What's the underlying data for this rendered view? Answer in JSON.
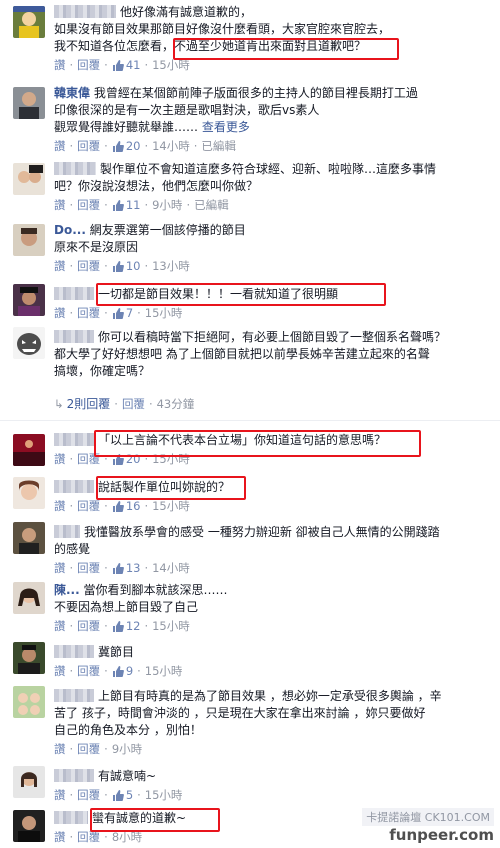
{
  "ui": {
    "like_label": "讚",
    "reply_label": "回覆",
    "like_icon": "thumbs-up-icon",
    "accent_color": "#3b5998",
    "highlight_color": "#e8141c"
  },
  "comments": [
    {
      "name": "Yoshi Yu Ting",
      "lines": [
        "他好像滿有誠意道歉的，",
        "如果沒有節目效果那節目好像沒什麼看頭，大家官腔來官腔去，",
        "我不知道各位怎麼看，不過至少她道肯出來面對且道歉吧？"
      ],
      "likes": "41",
      "time": "15小時"
    },
    {
      "name": "韓東偉",
      "lines": [
        "我曾經在某個節前陣子版面很多的主持人的節目裡長期打工過",
        "印像很深的是有一次主題是歌唱對決，歌后vs素人",
        "觀眾覺得誰好聽就舉誰……"
      ],
      "see_more": "查看更多",
      "likes": "20",
      "time": "14小時",
      "edited": "已編輯"
    },
    {
      "name": "",
      "lines": [
        "製作單位不會知道這麼多符合球經、迎新、啦啦隊…這麼多事情",
        "吧？你沒說沒想法，他們怎麼叫你做？"
      ],
      "likes": "11",
      "time": "9小時",
      "edited": "已編輯"
    },
    {
      "name": "Do...",
      "lines": [
        "網友票選第一個該停播的節目",
        "原來不是沒原因"
      ],
      "likes": "10",
      "time": "13小時"
    },
    {
      "name": "",
      "lines": [
        "一切都是節目效果！！！一看就知道了很明顯"
      ],
      "likes": "7",
      "time": "15小時"
    },
    {
      "name": "",
      "lines": [
        "你可以看稿時當下拒絕阿，有必要上個節目毀了一整個系名聲嗎？",
        "都大學了好好想想吧 為了上個節目就把以前學長姊辛苦建立起來的名聲",
        "搞壞，你確定嗎？"
      ],
      "likes": "",
      "time": "",
      "replies": "2則回覆",
      "reply_time": "43分鐘"
    },
    {
      "name": "",
      "lines": [
        "「以上言論不代表本台立場」你知道這句話的意思嗎？"
      ],
      "likes": "20",
      "time": "15小時"
    },
    {
      "name": "",
      "lines": [
        "說話製作單位叫妳說的？"
      ],
      "likes": "16",
      "time": "15小時"
    },
    {
      "name": "",
      "lines": [
        "我懂醫放系學會的感受 一種努力辦迎新 卻被自己人無情的公開踐踏",
        "的感覺"
      ],
      "likes": "13",
      "time": "14小時"
    },
    {
      "name": "陳...",
      "lines": [
        "當你看到腳本就該深思……",
        "不要因為想上節目毀了自己"
      ],
      "likes": "12",
      "time": "15小時"
    },
    {
      "name": "",
      "lines": [
        "冀節目"
      ],
      "likes": "9",
      "time": "15小時"
    },
    {
      "name": "",
      "lines": [
        "上節目有時真的是為了節目效果 ，想必妳一定承受很多輿論 ，辛",
        "苦了 孩子，時間會沖淡的 ，只是現在大家在拿出來討論 ，妳只要做好",
        "自己的角色及本分 ，別怕！"
      ],
      "likes": "",
      "time": "9小時"
    },
    {
      "name": "",
      "lines": [
        "有誠意喃~"
      ],
      "likes": "5",
      "time": "15小時"
    },
    {
      "name": "",
      "lines": [
        "蠻有誠意的道歉~"
      ],
      "likes": "",
      "time": "8小時"
    }
  ],
  "watermark": {
    "line1": "卡提諾論壇 CK101.COM",
    "line2": "funpeer.com"
  }
}
